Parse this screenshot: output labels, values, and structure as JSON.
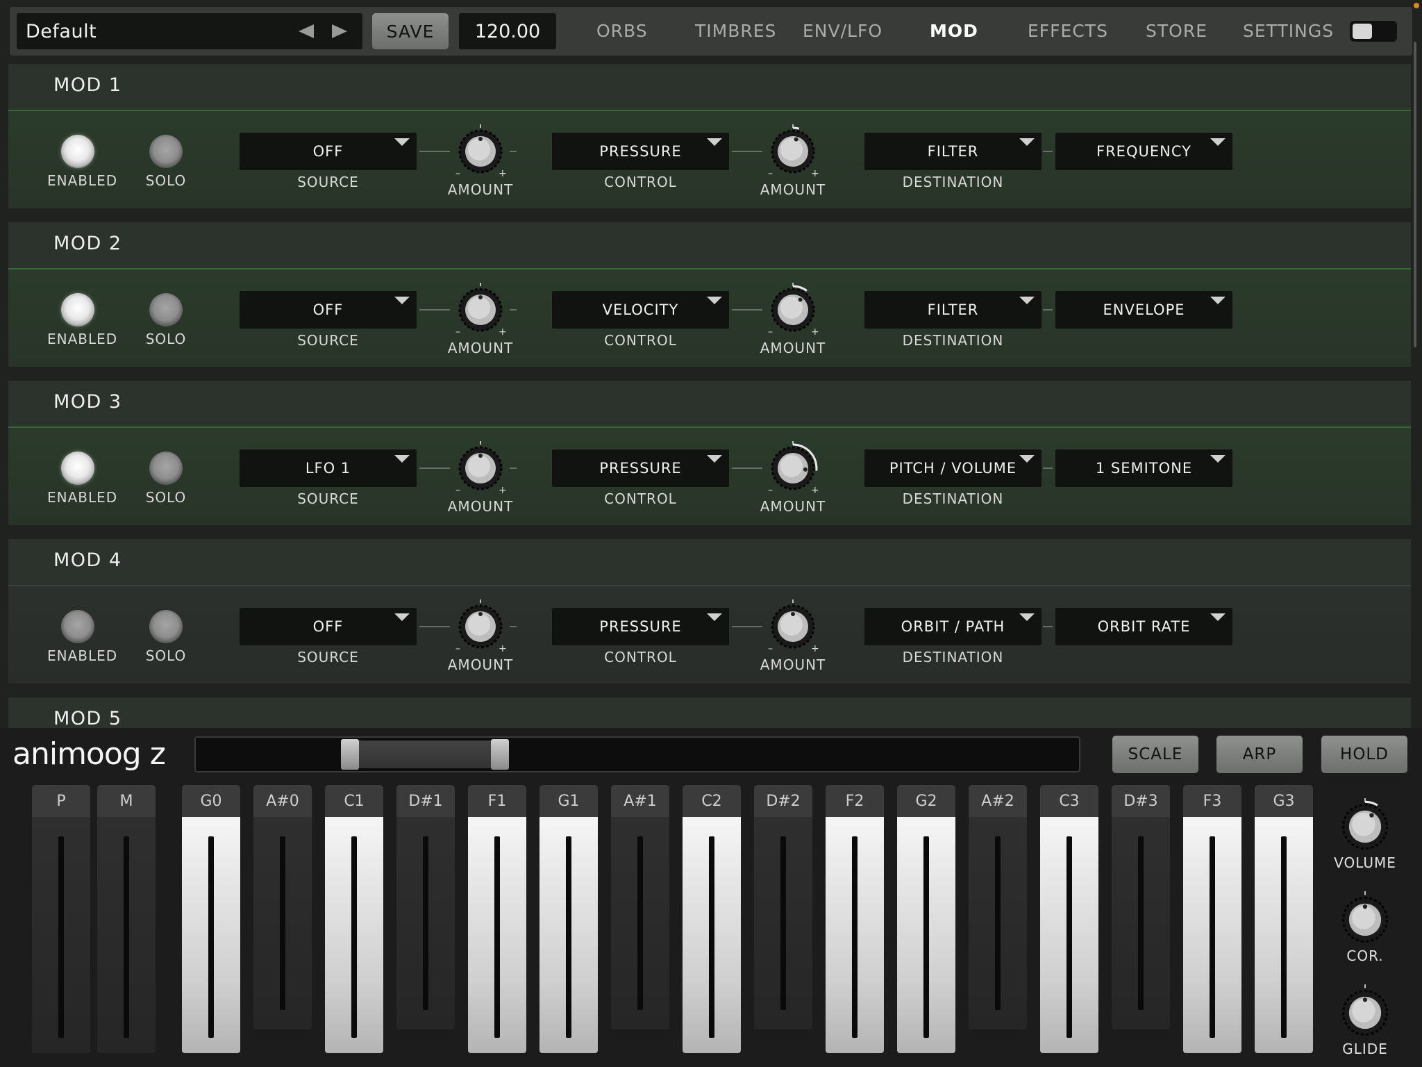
{
  "topbar": {
    "preset_name": "Default",
    "save_label": "SAVE",
    "tempo": "120.00",
    "tabs": [
      {
        "label": "ORBS",
        "active": false
      },
      {
        "label": "TIMBRES",
        "active": false
      },
      {
        "label": "ENV/LFO",
        "active": false
      },
      {
        "label": "MOD",
        "active": true
      },
      {
        "label": "EFFECTS",
        "active": false
      },
      {
        "label": "STORE",
        "active": false
      },
      {
        "label": "SETTINGS",
        "active": false
      }
    ]
  },
  "labels": {
    "enabled": "ENABLED",
    "solo": "SOLO",
    "source": "SOURCE",
    "amount": "AMOUNT",
    "control": "CONTROL",
    "destination": "DESTINATION",
    "minus": "–",
    "plus": "+"
  },
  "mods": [
    {
      "title": "MOD 1",
      "enabled": true,
      "source": "OFF",
      "control": "PRESSURE",
      "destination": "FILTER",
      "target": "FREQUENCY",
      "amount1": 0.5,
      "amount2": 0.55
    },
    {
      "title": "MOD 2",
      "enabled": true,
      "source": "OFF",
      "control": "VELOCITY",
      "destination": "FILTER",
      "target": "ENVELOPE",
      "amount1": 0.5,
      "amount2": 0.62
    },
    {
      "title": "MOD 3",
      "enabled": true,
      "source": "LFO 1",
      "control": "PRESSURE",
      "destination": "PITCH / VOLUME",
      "target": "1 SEMITONE",
      "amount1": 0.5,
      "amount2": 0.82
    },
    {
      "title": "MOD 4",
      "enabled": false,
      "source": "OFF",
      "control": "PRESSURE",
      "destination": "ORBIT / PATH",
      "target": "ORBIT RATE",
      "amount1": 0.5,
      "amount2": 0.5
    },
    {
      "title": "MOD 5"
    }
  ],
  "keyboard": {
    "logo": "animoog z",
    "scale_label": "SCALE",
    "arp_label": "ARP",
    "hold_label": "HOLD",
    "range_low": 0.16,
    "range_high": 0.33,
    "keys": [
      {
        "label": "P",
        "type": "strip"
      },
      {
        "label": "M",
        "type": "strip"
      },
      {
        "label": "G0",
        "type": "white"
      },
      {
        "label": "A#0",
        "type": "black"
      },
      {
        "label": "C1",
        "type": "white"
      },
      {
        "label": "D#1",
        "type": "black"
      },
      {
        "label": "F1",
        "type": "white"
      },
      {
        "label": "G1",
        "type": "white"
      },
      {
        "label": "A#1",
        "type": "black"
      },
      {
        "label": "C2",
        "type": "white"
      },
      {
        "label": "D#2",
        "type": "black"
      },
      {
        "label": "F2",
        "type": "white"
      },
      {
        "label": "G2",
        "type": "white"
      },
      {
        "label": "A#2",
        "type": "black"
      },
      {
        "label": "C3",
        "type": "white"
      },
      {
        "label": "D#3",
        "type": "black"
      },
      {
        "label": "F3",
        "type": "white"
      },
      {
        "label": "G3",
        "type": "white"
      }
    ],
    "side_knobs": [
      {
        "label": "VOLUME",
        "value": 0.6
      },
      {
        "label": "COR.",
        "value": 0.5
      },
      {
        "label": "GLIDE",
        "value": 0.5
      }
    ]
  },
  "colors": {
    "accent_green": "#3a6a34",
    "panel_bg": "#2c332c",
    "dropdown_bg": "#111311",
    "button_gray": "#8f918f"
  },
  "icons": {
    "prev": "triangle-left-icon",
    "next": "triangle-right-icon",
    "dropdown": "caret-down-icon"
  }
}
